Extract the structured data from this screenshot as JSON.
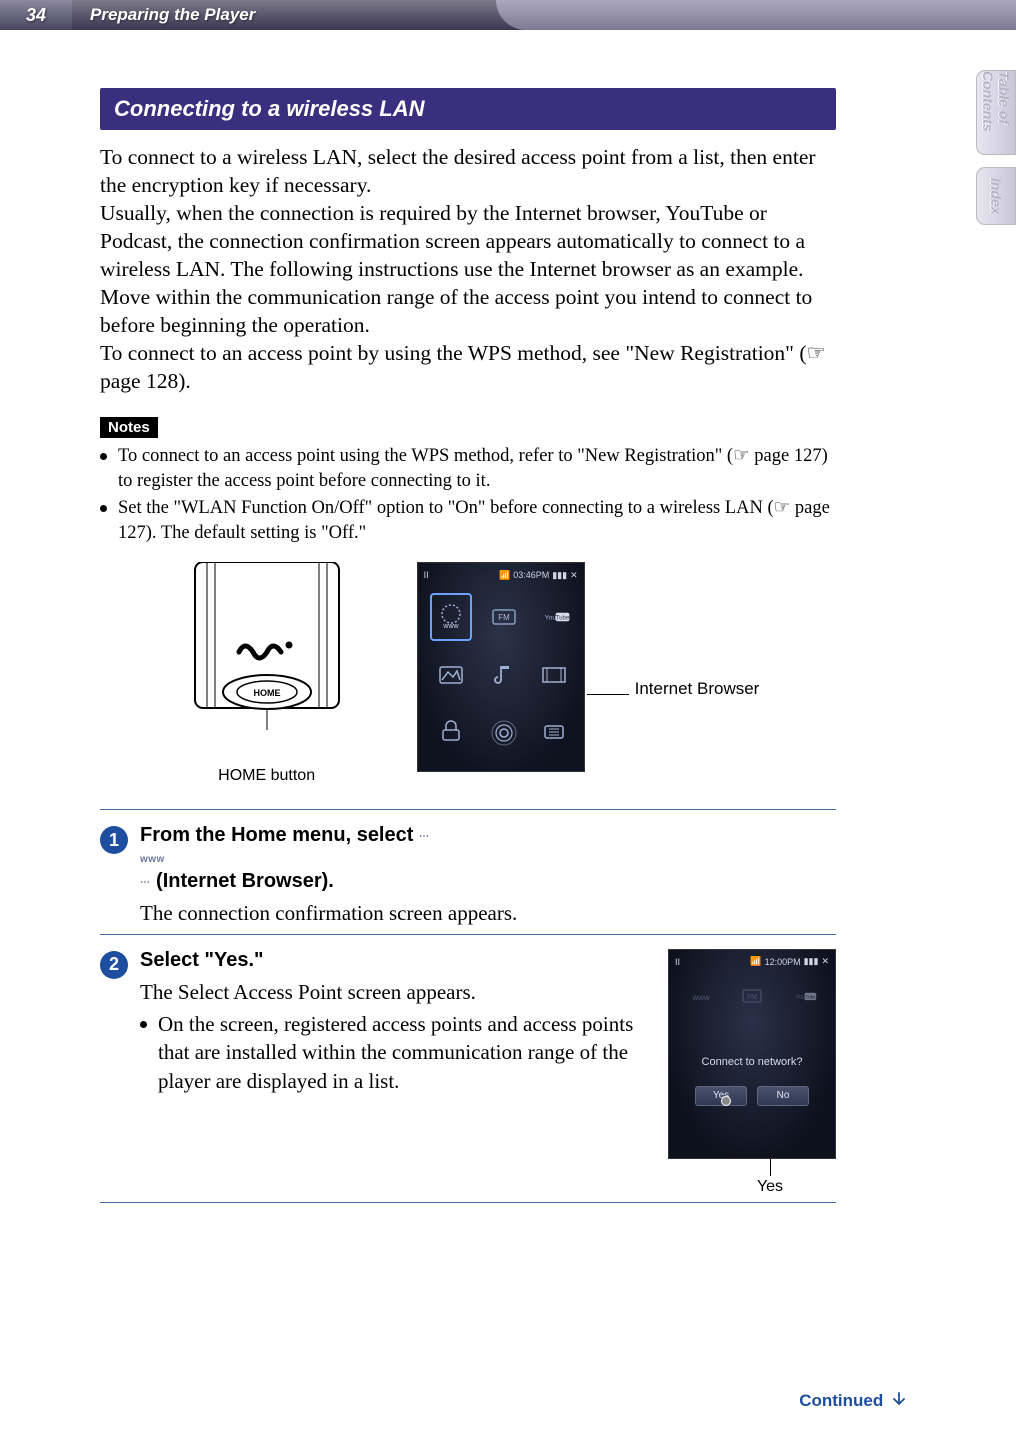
{
  "header": {
    "page_number": "34",
    "chapter": "Preparing the Player"
  },
  "side_tabs": {
    "toc": "Table of Contents",
    "index": "Index"
  },
  "section_title": "Connecting to a wireless LAN",
  "intro_paragraph": "To connect to a wireless LAN, select the desired access point from a list, then enter the encryption key if necessary.\nUsually, when the connection is required by the Internet browser, YouTube or Podcast, the connection confirmation screen appears automatically to connect to a wireless LAN. The following instructions use the Internet browser as an example. Move within the communication range of the access point you intend to connect to before beginning the operation.\nTo connect to an access point by using the WPS method, see \"New Registration\" (☞ page 128).",
  "notes_label": "Notes",
  "notes": [
    "To connect to an access point using the WPS method, refer to \"New Registration\" (☞ page 127) to register the access point before connecting to it.",
    "Set the \"WLAN Function On/Off\" option to \"On\" before connecting to a wireless LAN (☞ page 127). The default setting is \"Off.\""
  ],
  "figure1": {
    "home_button_text": "HOME",
    "home_label": "HOME button",
    "screen_label": "Internet Browser",
    "statusbar_left": "II",
    "statusbar_time": "03:46PM",
    "icons": {
      "www": "www",
      "fm": "FM",
      "youtube": "YouTube"
    }
  },
  "steps": {
    "s1": {
      "num": "1",
      "title_pre": "From the Home menu, select ",
      "title_post": " (Internet Browser).",
      "www_glyph": "www",
      "body": "The connection confirmation screen appears."
    },
    "s2": {
      "num": "2",
      "title": "Select \"Yes.\"",
      "line1": "The Select Access Point screen appears.",
      "bullet": "On the screen, registered access points and access points that are installed within the communication range of the player are displayed in a list.",
      "screen": {
        "statusbar_left": "II",
        "statusbar_time": "12:00PM",
        "dialog_text": "Connect to network?",
        "yes": "Yes",
        "no": "No"
      },
      "yes_label": "Yes"
    }
  },
  "continued": "Continued"
}
